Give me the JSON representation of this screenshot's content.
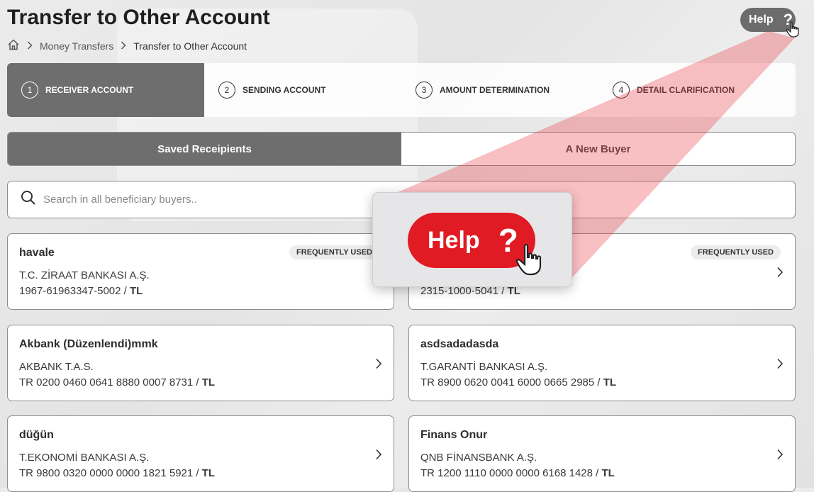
{
  "page": {
    "title": "Transfer to Other Account"
  },
  "breadcrumb": {
    "items": [
      "Money Transfers",
      "Transfer to Other Account"
    ]
  },
  "help": {
    "label": "Help",
    "symbol": "?"
  },
  "steps": [
    {
      "num": "1",
      "label": "RECEIVER ACCOUNT",
      "active": true
    },
    {
      "num": "2",
      "label": "SENDING ACCOUNT"
    },
    {
      "num": "3",
      "label": "AMOUNT DETERMINATION"
    },
    {
      "num": "4",
      "label": "DETAIL CLARIFICATION"
    }
  ],
  "tabs": [
    {
      "label": "Saved Receipients",
      "active": true
    },
    {
      "label": "A New Buyer"
    }
  ],
  "search": {
    "placeholder": "Search in all beneficiary buyers..",
    "value": ""
  },
  "cards": [
    {
      "name": "havale",
      "bank": "T.C. ZİRAAT BANKASI A.Ş.",
      "account": "1967-61963347-5002",
      "currency": "TL",
      "badge": "FREQUENTLY USED"
    },
    {
      "name": "",
      "bank": "",
      "account": "2315-1000-5041",
      "currency": "TL",
      "badge": "FREQUENTLY USED"
    },
    {
      "name": "Akbank (Düzenlendi)mmk",
      "bank": "AKBANK T.A.S.",
      "account": "TR 0200 0460 0641 8880 0007 8731",
      "currency": "TL"
    },
    {
      "name": "asdsadadasda",
      "bank": "T.GARANTİ BANKASI A.Ş.",
      "account": "TR 8900 0620 0041 6000 0665 2985",
      "currency": "TL"
    },
    {
      "name": "düğün",
      "bank": "T.EKONOMİ BANKASI A.Ş.",
      "account": "TR 9800 0320 0000 0000 1821 5921",
      "currency": "TL"
    },
    {
      "name": "Finans Onur",
      "bank": "QNB FİNANSBANK A.Ş.",
      "account": "TR 1200 1110 0000 0000 6168 1428",
      "currency": "TL"
    }
  ],
  "acct_sep": " / ",
  "colors": {
    "accent": "#e01b24",
    "active_gray": "#6e6e6e"
  }
}
